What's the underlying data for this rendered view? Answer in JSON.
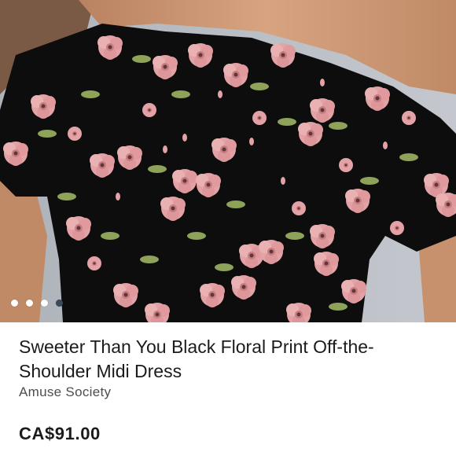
{
  "listing": {
    "title": "Sweeter Than You Black Floral Print Off-the-Shoulder Midi Dress",
    "brand": "Amuse Society",
    "price": "CA$91.00"
  },
  "gallery": {
    "image_count": 4,
    "active_index": 3
  },
  "colors": {
    "dress": "#0d0d0d",
    "flower": "#e3a3a6",
    "leaf": "#8fa25a",
    "skin": "#c9946f",
    "background": "#b7bcc3"
  }
}
